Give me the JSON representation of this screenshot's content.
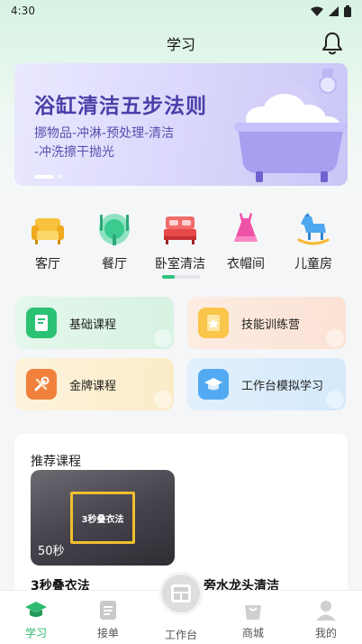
{
  "status_bar": {
    "time": "4:30"
  },
  "header": {
    "title": "学习"
  },
  "banner": {
    "title": "浴缸清洁五步法则",
    "subtitle_line1": "挪物品-冲淋-预处理-清洁",
    "subtitle_line2": "-冲洗擦干抛光"
  },
  "categories": [
    {
      "label": "客厅",
      "icon": "sofa-icon"
    },
    {
      "label": "餐厅",
      "icon": "dining-icon"
    },
    {
      "label": "卧室清洁",
      "icon": "bed-icon"
    },
    {
      "label": "衣帽间",
      "icon": "dress-icon"
    },
    {
      "label": "儿童房",
      "icon": "rocking-horse-icon"
    }
  ],
  "cards": [
    {
      "label": "基础课程",
      "icon": "book-icon",
      "color": "#e4f7ec"
    },
    {
      "label": "技能训练营",
      "icon": "medal-icon",
      "color": "#fdece2"
    },
    {
      "label": "金牌课程",
      "icon": "tools-icon",
      "color": "#fdf3dc"
    },
    {
      "label": "工作台模拟学习",
      "icon": "graduation-cap-icon",
      "color": "#e2f0fd"
    }
  ],
  "recommend": {
    "title": "推荐课程",
    "courses": [
      {
        "title": "3秒叠衣法",
        "thumb_text": "3秒叠衣法",
        "duration": "50秒"
      },
      {
        "title": "旁水龙头清洁"
      }
    ]
  },
  "bottom_nav": [
    {
      "label": "学习",
      "icon": "graduation-cap-icon",
      "active": true
    },
    {
      "label": "接单",
      "icon": "clipboard-icon"
    },
    {
      "label": "工作台",
      "icon": "workbench-icon"
    },
    {
      "label": "商城",
      "icon": "shopping-bag-icon"
    },
    {
      "label": "我的",
      "icon": "user-icon"
    }
  ],
  "colors": {
    "accent": "#31c27c",
    "banner_text": "#4c3ea8"
  }
}
